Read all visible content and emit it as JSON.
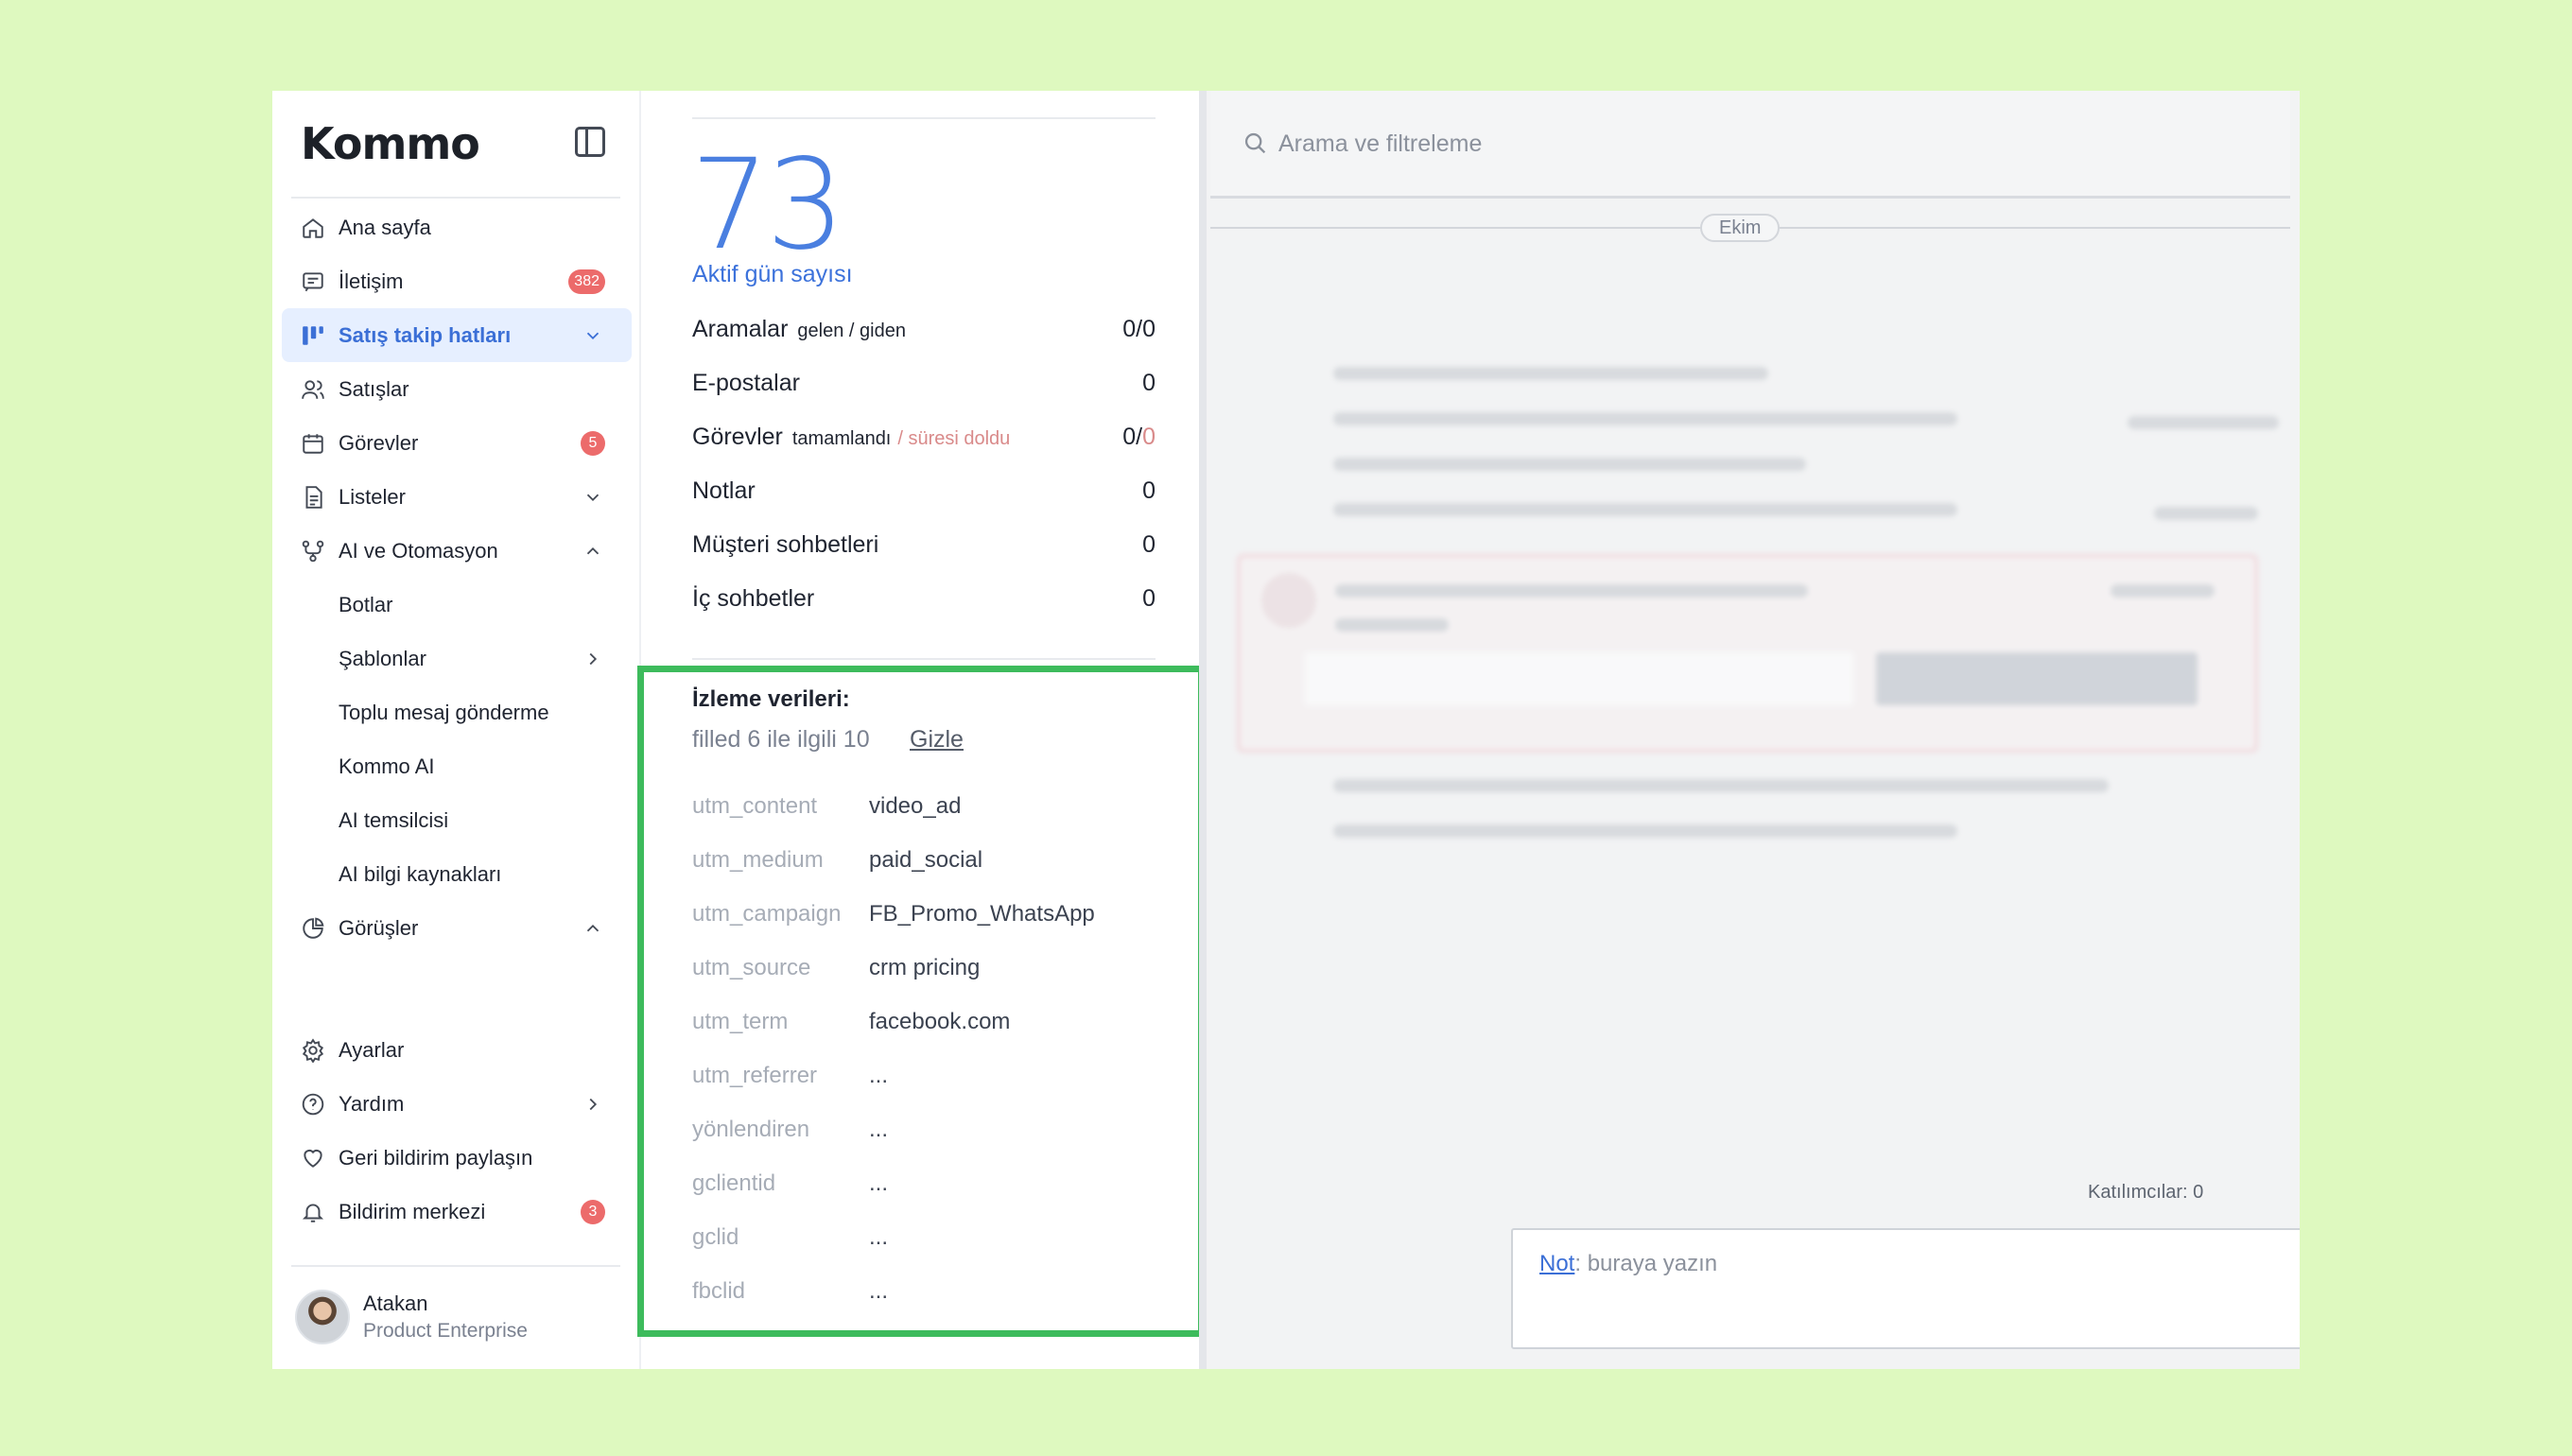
{
  "brand": {
    "logo_text": "Kommo"
  },
  "sidebar": {
    "items": [
      {
        "label": "Ana sayfa",
        "icon": "home-icon"
      },
      {
        "label": "İletişim",
        "icon": "chat-icon",
        "badge": "382"
      },
      {
        "label": "Satış takip hatları",
        "icon": "pipeline-icon",
        "active": true
      },
      {
        "label": "Satışlar",
        "icon": "users-icon"
      },
      {
        "label": "Görevler",
        "icon": "calendar-icon",
        "badge": "5"
      },
      {
        "label": "Listeler",
        "icon": "list-icon"
      },
      {
        "label": "AI ve Otomasyon",
        "icon": "automation-icon"
      },
      {
        "label": "Botlar"
      },
      {
        "label": "Şablonlar"
      },
      {
        "label": "Toplu mesaj gönderme"
      },
      {
        "label": "Kommo AI"
      },
      {
        "label": "AI temsilcisi"
      },
      {
        "label": "AI bilgi kaynakları"
      },
      {
        "label": "Görüşler",
        "icon": "pie-chart-icon"
      }
    ],
    "bottom_items": [
      {
        "label": "Ayarlar",
        "icon": "gear-icon"
      },
      {
        "label": "Yardım",
        "icon": "help-icon"
      },
      {
        "label": "Geri bildirim paylaşın",
        "icon": "heart-icon"
      },
      {
        "label": "Bildirim merkezi",
        "icon": "bell-icon",
        "badge": "3"
      }
    ],
    "user": {
      "name": "Atakan",
      "role": "Product Enterprise"
    }
  },
  "stats": {
    "active_days_value": "73",
    "active_days_label": "Aktif gün sayısı",
    "rows": [
      {
        "label": "Aramalar",
        "sub": "gelen / giden",
        "value": "0/0"
      },
      {
        "label": "E-postalar",
        "value": "0"
      },
      {
        "label": "Görevler",
        "sub": "tamamlandı",
        "sub_muted": "/ süresi doldu",
        "value": "0/",
        "value_muted": "0"
      },
      {
        "label": "Notlar",
        "value": "0"
      },
      {
        "label": "Müşteri sohbetleri",
        "value": "0"
      },
      {
        "label": "İç sohbetler",
        "value": "0"
      }
    ]
  },
  "tracking": {
    "title": "İzleme verileri:",
    "summary": "filled 6 ile ilgili 10",
    "hide_label": "Gizle",
    "rows": [
      {
        "key": "utm_content",
        "value": "video_ad"
      },
      {
        "key": "utm_medium",
        "value": "paid_social"
      },
      {
        "key": "utm_campaign",
        "value": "FB_Promo_WhatsApp"
      },
      {
        "key": "utm_source",
        "value": "crm pricing"
      },
      {
        "key": "utm_term",
        "value": "facebook.com"
      },
      {
        "key": "utm_referrer",
        "value": "..."
      },
      {
        "key": "yönlendiren",
        "value": "..."
      },
      {
        "key": "gclientid",
        "value": "..."
      },
      {
        "key": "gclid",
        "value": "..."
      },
      {
        "key": "fbclid",
        "value": "..."
      }
    ]
  },
  "feed": {
    "search_placeholder": "Arama ve filtreleme",
    "date_label": "Ekim",
    "participants": "Katılımcılar: 0",
    "note_link": "Not",
    "note_placeholder": ": buraya yazın"
  },
  "colors": {
    "accent": "#3b6fd6",
    "badge": "#ec6b6b",
    "highlight": "#3dbb5c",
    "background": "#def9bf"
  }
}
